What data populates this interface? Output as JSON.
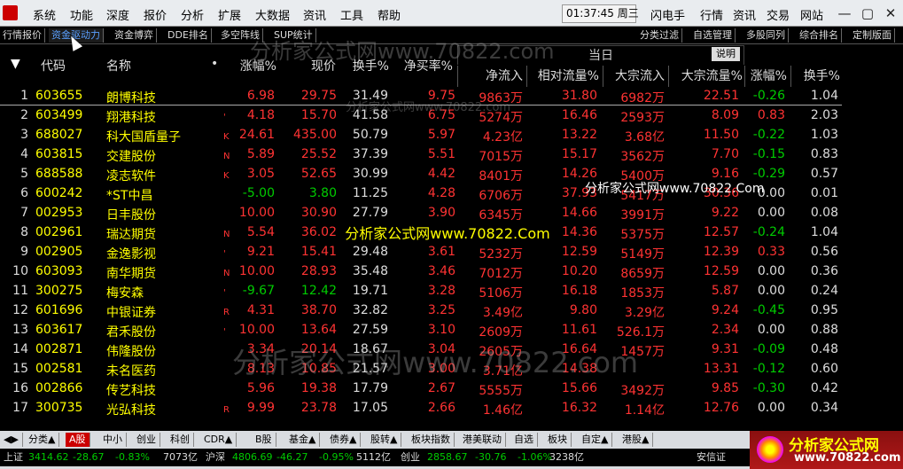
{
  "menu": {
    "items": [
      "系统",
      "功能",
      "深度",
      "报价",
      "分析",
      "扩展",
      "大数据",
      "资讯",
      "工具",
      "帮助"
    ],
    "time": "01:37:45",
    "weekday": "周三",
    "right": [
      "闪电手",
      "行情",
      "资讯",
      "交易",
      "网站"
    ]
  },
  "tabs": {
    "left": [
      "行情报价",
      "资金驱动力",
      "资金博弈",
      "DDE排名",
      "多空阵线",
      "SUP统计"
    ],
    "right": [
      "分类过滤",
      "自选管理",
      "多股同列",
      "综合排名",
      "定制版面"
    ]
  },
  "header": {
    "code": "代码",
    "name": "名称",
    "cols": [
      "涨幅%",
      "现价",
      "换手%",
      "净买率%",
      "净流入",
      "相对流量%",
      "大宗流入",
      "大宗流量%",
      "涨幅%",
      "换手%"
    ],
    "group": "当日",
    "explain": "说明"
  },
  "rows": [
    {
      "i": "1",
      "code": "603655",
      "name": "朗博科技",
      "flag": "",
      "chg": "6.98",
      "price": "29.75",
      "turn": "31.49",
      "net": "9.75",
      "inflow": "9863万",
      "rel": "31.80",
      "big": "6982万",
      "bigr": "22.51",
      "chg2": "-0.26",
      "turn2": "1.04"
    },
    {
      "i": "2",
      "code": "603499",
      "name": "翔港科技",
      "flag": "'",
      "chg": "4.18",
      "price": "15.70",
      "turn": "41.58",
      "net": "6.75",
      "inflow": "5274万",
      "rel": "16.46",
      "big": "2593万",
      "bigr": "8.09",
      "chg2": "0.83",
      "turn2": "2.03"
    },
    {
      "i": "3",
      "code": "688027",
      "name": "科大国盾量子",
      "flag": "K",
      "chg": "24.61",
      "price": "435.00",
      "turn": "50.79",
      "net": "5.97",
      "inflow": "4.23亿",
      "rel": "13.22",
      "big": "3.68亿",
      "bigr": "11.50",
      "chg2": "-0.22",
      "turn2": "1.03"
    },
    {
      "i": "4",
      "code": "603815",
      "name": "交建股份",
      "flag": "N",
      "chg": "5.89",
      "price": "25.52",
      "turn": "37.39",
      "net": "5.51",
      "inflow": "7015万",
      "rel": "15.17",
      "big": "3562万",
      "bigr": "7.70",
      "chg2": "-0.15",
      "turn2": "0.83"
    },
    {
      "i": "5",
      "code": "688588",
      "name": "凌志软件",
      "flag": "K",
      "chg": "3.05",
      "price": "52.65",
      "turn": "30.99",
      "net": "4.42",
      "inflow": "8401万",
      "rel": "14.26",
      "big": "5400万",
      "bigr": "9.16",
      "chg2": "-0.29",
      "turn2": "0.57"
    },
    {
      "i": "6",
      "code": "600242",
      "name": "*ST中昌",
      "flag": "",
      "chg": "-5.00",
      "price": "3.80",
      "turn": "11.25",
      "net": "4.28",
      "inflow": "6706万",
      "rel": "37.93",
      "big": "5417万",
      "bigr": "30.36",
      "chg2": "0.00",
      "turn2": "0.01"
    },
    {
      "i": "7",
      "code": "002953",
      "name": "日丰股份",
      "flag": "",
      "chg": "10.00",
      "price": "30.90",
      "turn": "27.79",
      "net": "3.90",
      "inflow": "6345万",
      "rel": "14.66",
      "big": "3991万",
      "bigr": "9.22",
      "chg2": "0.00",
      "turn2": "0.08"
    },
    {
      "i": "8",
      "code": "002961",
      "name": "瑞达期货",
      "flag": "N",
      "chg": "5.54",
      "price": "36.02",
      "turn": "",
      "net": "",
      "inflow": "",
      "rel": "14.36",
      "big": "5375万",
      "bigr": "12.57",
      "chg2": "-0.24",
      "turn2": "1.04"
    },
    {
      "i": "9",
      "code": "002905",
      "name": "金逸影视",
      "flag": "'",
      "chg": "9.21",
      "price": "15.41",
      "turn": "29.48",
      "net": "3.61",
      "inflow": "5232万",
      "rel": "12.59",
      "big": "5149万",
      "bigr": "12.39",
      "chg2": "0.33",
      "turn2": "0.56"
    },
    {
      "i": "10",
      "code": "603093",
      "name": "南华期货",
      "flag": "N",
      "chg": "10.00",
      "price": "28.93",
      "turn": "35.48",
      "net": "3.46",
      "inflow": "7012万",
      "rel": "10.20",
      "big": "8659万",
      "bigr": "12.59",
      "chg2": "0.00",
      "turn2": "0.36"
    },
    {
      "i": "11",
      "code": "300275",
      "name": "梅安森",
      "flag": "'",
      "chg": "-9.67",
      "price": "12.42",
      "turn": "19.71",
      "net": "3.28",
      "inflow": "5106万",
      "rel": "16.18",
      "big": "1853万",
      "bigr": "5.87",
      "chg2": "0.00",
      "turn2": "0.24"
    },
    {
      "i": "12",
      "code": "601696",
      "name": "中银证券",
      "flag": "R",
      "chg": "4.31",
      "price": "38.70",
      "turn": "32.82",
      "net": "3.25",
      "inflow": "3.49亿",
      "rel": "9.80",
      "big": "3.29亿",
      "bigr": "9.24",
      "chg2": "-0.45",
      "turn2": "0.95"
    },
    {
      "i": "13",
      "code": "603617",
      "name": "君禾股份",
      "flag": "'",
      "chg": "10.00",
      "price": "13.64",
      "turn": "27.59",
      "net": "3.10",
      "inflow": "2609万",
      "rel": "11.61",
      "big": "526.1万",
      "bigr": "2.34",
      "chg2": "0.00",
      "turn2": "0.88"
    },
    {
      "i": "14",
      "code": "002871",
      "name": "伟隆股份",
      "flag": "",
      "chg": "3.34",
      "price": "20.14",
      "turn": "18.67",
      "net": "3.04",
      "inflow": "2605万",
      "rel": "16.64",
      "big": "1457万",
      "bigr": "9.31",
      "chg2": "-0.09",
      "turn2": "0.48"
    },
    {
      "i": "15",
      "code": "002581",
      "name": "未名医药",
      "flag": "",
      "chg": "8.13",
      "price": "10.85",
      "turn": "21.57",
      "net": "3.00",
      "inflow": "3.71亿",
      "rel": "14.38",
      "big": "",
      "bigr": "13.31",
      "chg2": "-0.12",
      "turn2": "0.60"
    },
    {
      "i": "16",
      "code": "002866",
      "name": "传艺科技",
      "flag": "",
      "chg": "5.96",
      "price": "19.38",
      "turn": "17.79",
      "net": "2.67",
      "inflow": "5555万",
      "rel": "15.66",
      "big": "3492万",
      "bigr": "9.85",
      "chg2": "-0.30",
      "turn2": "0.42"
    },
    {
      "i": "17",
      "code": "300735",
      "name": "光弘科技",
      "flag": "R",
      "chg": "9.99",
      "price": "23.78",
      "turn": "17.05",
      "net": "2.66",
      "inflow": "1.46亿",
      "rel": "16.32",
      "big": "1.14亿",
      "bigr": "12.76",
      "chg2": "0.00",
      "turn2": "0.34"
    }
  ],
  "bottom_tabs": [
    "分类▲",
    "A股",
    "中小",
    "创业",
    "科创",
    "CDR▲",
    "B股",
    "基金▲",
    "债券▲",
    "股转▲",
    "板块指数",
    "港美联动",
    "自选",
    "板块",
    "自定▲",
    "港股▲"
  ],
  "status": {
    "sh": "上证",
    "sh_v": "3414.62",
    "sh_c": "-28.67",
    "sh_p": "-0.83%",
    "sh_a": "7073亿",
    "sz": "沪深",
    "sz_v": "4806.69",
    "sz_c": "-46.27",
    "sz_p": "-0.95%",
    "sz_a": "5112亿",
    "cy": "创业",
    "cy_v": "2858.67",
    "cy_c": "-30.76",
    "cy_p": "-1.06%",
    "cy_a": "3238亿",
    "right": "安信证"
  },
  "watermarks": {
    "w1": "分析家公式网www.70822.com",
    "w2": "分析家公式网www.70822.Com",
    "w3": "分析家公式网www.70822.Com",
    "w4": "分析家公式网www.70822.com",
    "brand": "分析家公式网",
    "brand_url": "www.70822.com"
  }
}
